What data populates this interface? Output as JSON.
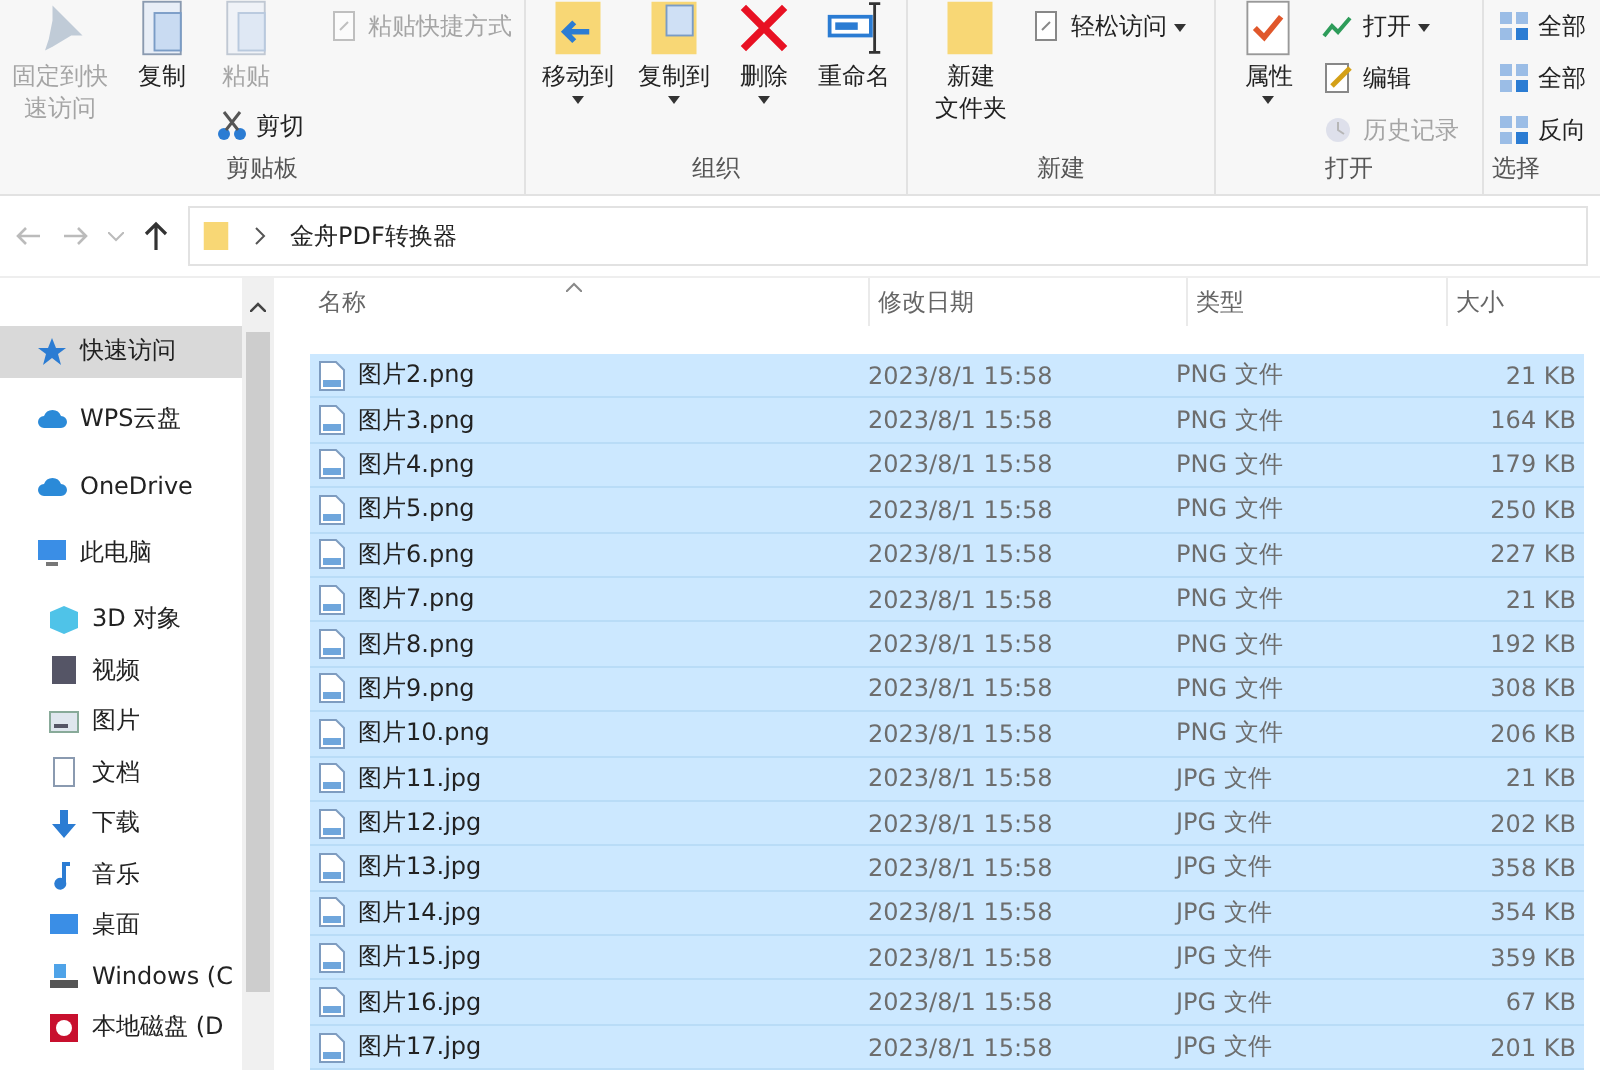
{
  "ribbon": {
    "groups": [
      {
        "label": "剪贴板",
        "columns": [
          [
            {
              "kind": "large",
              "lines": [
                "固定到快",
                "速访问"
              ],
              "disabled": true,
              "dropdown": false
            }
          ],
          [
            {
              "kind": "large",
              "lines": [
                "复制"
              ],
              "disabled": false,
              "dropdown": false
            }
          ],
          [
            {
              "kind": "large",
              "lines": [
                "粘贴"
              ],
              "disabled": true,
              "dropdown": false
            },
            {
              "kind": "small",
              "lines": [
                "剪切"
              ],
              "disabled": false,
              "dropdown": false
            }
          ],
          [
            {
              "kind": "small",
              "lines": [
                "粘贴快捷方式"
              ],
              "disabled": true,
              "dropdown": false
            }
          ]
        ]
      },
      {
        "label": "组织",
        "columns": [
          [
            {
              "kind": "large",
              "lines": [
                "移动到"
              ],
              "disabled": false,
              "dropdown": true
            }
          ],
          [
            {
              "kind": "large",
              "lines": [
                "复制到"
              ],
              "disabled": false,
              "dropdown": true
            }
          ],
          [
            {
              "kind": "large",
              "lines": [
                "删除"
              ],
              "disabled": false,
              "dropdown": true
            }
          ],
          [
            {
              "kind": "large",
              "lines": [
                "重命名"
              ],
              "disabled": false,
              "dropdown": false
            }
          ]
        ]
      },
      {
        "label": "新建",
        "columns": [
          [
            {
              "kind": "large",
              "lines": [
                "新建",
                "文件夹"
              ],
              "disabled": false,
              "dropdown": false
            }
          ],
          [
            {
              "kind": "small",
              "lines": [
                "轻松访问"
              ],
              "disabled": false,
              "dropdown": true
            }
          ]
        ]
      },
      {
        "label": "打开",
        "columns": [
          [
            {
              "kind": "large",
              "lines": [
                "属性"
              ],
              "disabled": false,
              "dropdown": true
            }
          ],
          [
            {
              "kind": "small",
              "lines": [
                "打开"
              ],
              "disabled": false,
              "dropdown": true
            },
            {
              "kind": "small",
              "lines": [
                "编辑"
              ],
              "disabled": false,
              "dropdown": false
            },
            {
              "kind": "small",
              "lines": [
                "历史记录"
              ],
              "disabled": true,
              "dropdown": false
            }
          ]
        ]
      },
      {
        "label": "选择",
        "columns": [
          [
            {
              "kind": "small",
              "lines": [
                "全部"
              ],
              "disabled": false,
              "dropdown": false
            },
            {
              "kind": "small",
              "lines": [
                "全部"
              ],
              "disabled": false,
              "dropdown": false
            },
            {
              "kind": "small",
              "lines": [
                "反向"
              ],
              "disabled": false,
              "dropdown": false
            }
          ]
        ]
      }
    ]
  },
  "address_bar": {
    "path": "金舟PDF转换器"
  },
  "sidebar": {
    "items": [
      {
        "label": "快速访问",
        "selected": true
      },
      {
        "label": "WPS云盘",
        "selected": false
      },
      {
        "label": "OneDrive",
        "selected": false
      },
      {
        "label": "此电脑",
        "selected": false,
        "children": [
          {
            "label": "3D 对象",
            "selected": false
          },
          {
            "label": "视频",
            "selected": false
          },
          {
            "label": "图片",
            "selected": false
          },
          {
            "label": "文档",
            "selected": false
          },
          {
            "label": "下载",
            "selected": false
          },
          {
            "label": "音乐",
            "selected": false
          },
          {
            "label": "桌面",
            "selected": false
          },
          {
            "label": "Windows (C",
            "selected": false
          },
          {
            "label": "本地磁盘 (D",
            "selected": false
          }
        ]
      }
    ]
  },
  "table": {
    "columns": [
      "名称",
      "修改日期",
      "类型",
      "大小"
    ],
    "rows": [
      {
        "name": "图片2.png",
        "date": "2023/8/1 15:58",
        "type": "PNG 文件",
        "size": "21 KB",
        "selected": true
      },
      {
        "name": "图片3.png",
        "date": "2023/8/1 15:58",
        "type": "PNG 文件",
        "size": "164 KB",
        "selected": true
      },
      {
        "name": "图片4.png",
        "date": "2023/8/1 15:58",
        "type": "PNG 文件",
        "size": "179 KB",
        "selected": true
      },
      {
        "name": "图片5.png",
        "date": "2023/8/1 15:58",
        "type": "PNG 文件",
        "size": "250 KB",
        "selected": true
      },
      {
        "name": "图片6.png",
        "date": "2023/8/1 15:58",
        "type": "PNG 文件",
        "size": "227 KB",
        "selected": true
      },
      {
        "name": "图片7.png",
        "date": "2023/8/1 15:58",
        "type": "PNG 文件",
        "size": "21 KB",
        "selected": true
      },
      {
        "name": "图片8.png",
        "date": "2023/8/1 15:58",
        "type": "PNG 文件",
        "size": "192 KB",
        "selected": true
      },
      {
        "name": "图片9.png",
        "date": "2023/8/1 15:58",
        "type": "PNG 文件",
        "size": "308 KB",
        "selected": true
      },
      {
        "name": "图片10.png",
        "date": "2023/8/1 15:58",
        "type": "PNG 文件",
        "size": "206 KB",
        "selected": true
      },
      {
        "name": "图片11.jpg",
        "date": "2023/8/1 15:58",
        "type": "JPG 文件",
        "size": "21 KB",
        "selected": true
      },
      {
        "name": "图片12.jpg",
        "date": "2023/8/1 15:58",
        "type": "JPG 文件",
        "size": "202 KB",
        "selected": true
      },
      {
        "name": "图片13.jpg",
        "date": "2023/8/1 15:58",
        "type": "JPG 文件",
        "size": "358 KB",
        "selected": true
      },
      {
        "name": "图片14.jpg",
        "date": "2023/8/1 15:58",
        "type": "JPG 文件",
        "size": "354 KB",
        "selected": true
      },
      {
        "name": "图片15.jpg",
        "date": "2023/8/1 15:58",
        "type": "JPG 文件",
        "size": "359 KB",
        "selected": true
      },
      {
        "name": "图片16.jpg",
        "date": "2023/8/1 15:58",
        "type": "JPG 文件",
        "size": "67 KB",
        "selected": true
      },
      {
        "name": "图片17.jpg",
        "date": "2023/8/1 15:58",
        "type": "JPG 文件",
        "size": "201 KB",
        "selected": true
      }
    ]
  }
}
